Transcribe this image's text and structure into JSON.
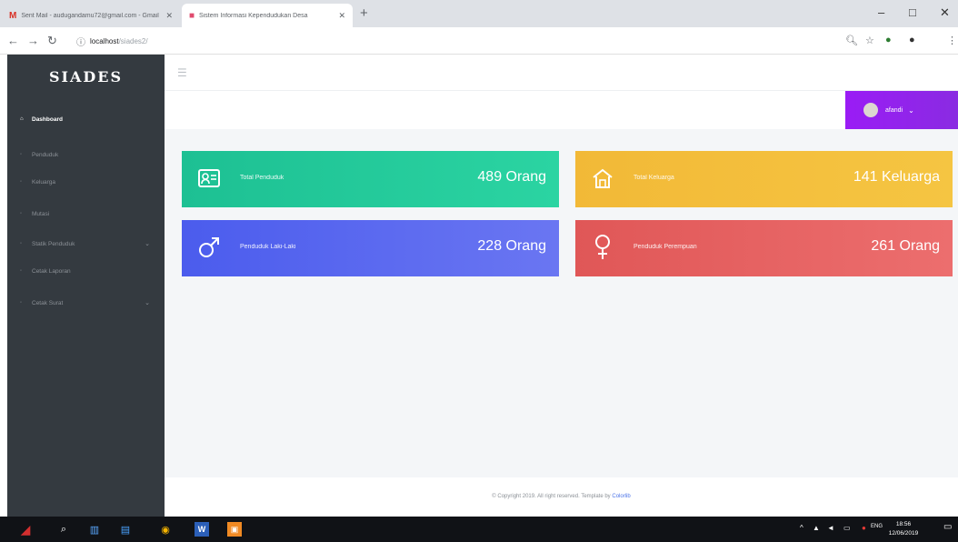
{
  "browser": {
    "tabs": [
      {
        "title": "Sent Mail - audugandamu72@gmail.com - Gmail",
        "icon": "gmail-icon",
        "active": false
      },
      {
        "title": "Sistem Informasi Kependudukan Desa",
        "icon": "page-favicon",
        "active": true
      }
    ],
    "url_host": "localhost",
    "url_path": "/siades2/",
    "new_tab": "+",
    "controls": {
      "minimize": "–",
      "maximize": "□",
      "close": "✕"
    }
  },
  "sidebar": {
    "brand": "SIADES",
    "items": [
      {
        "label": "Dashboard",
        "icon": "home-icon",
        "active": true,
        "has_arrow": false
      },
      {
        "label": "Penduduk",
        "icon": "users-icon",
        "active": false,
        "has_arrow": false
      },
      {
        "label": "Keluarga",
        "icon": "family-icon",
        "active": false,
        "has_arrow": false
      },
      {
        "label": "Mutasi",
        "icon": "transfer-icon",
        "active": false,
        "has_arrow": false
      },
      {
        "label": "Statik Penduduk",
        "icon": "stats-icon",
        "active": false,
        "has_arrow": true
      },
      {
        "label": "Cetak Laporan",
        "icon": "print-icon",
        "active": false,
        "has_arrow": false
      },
      {
        "label": "Cetak Surat",
        "icon": "mail-icon",
        "active": false,
        "has_arrow": true
      }
    ]
  },
  "header": {
    "menu_icon": "hamburger-icon",
    "user_name": "afandi",
    "user_color": "#9a1cf5"
  },
  "cards": {
    "penduduk": {
      "label": "Total Penduduk",
      "value": "489 Orang",
      "icon": "id-card-icon",
      "color": "#1dc093"
    },
    "keluarga": {
      "label": "Total Keluarga",
      "value": "141 Keluarga",
      "icon": "home-icon",
      "color": "#f2b937"
    },
    "laki": {
      "label": "Penduduk Laki-Laki",
      "value": "228 Orang",
      "icon": "male-icon",
      "color": "#4b5ced"
    },
    "perempuan": {
      "label": "Penduduk Perempuan",
      "value": "261 Orang",
      "icon": "female-icon",
      "color": "#e05757"
    }
  },
  "footer": {
    "text": "© Copyright 2019. All right reserved. Template by",
    "link": "Colorlib"
  },
  "taskbar": {
    "lang": "ENG",
    "time": "18:56",
    "date": "12/06/2019"
  }
}
